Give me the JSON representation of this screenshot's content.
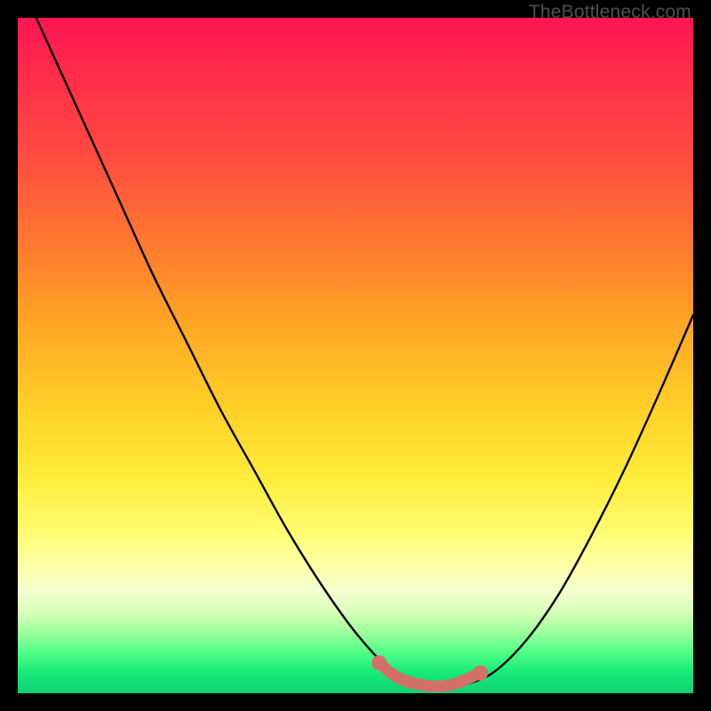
{
  "watermark": "TheBottleneck.com",
  "chart_data": {
    "type": "line",
    "title": "",
    "xlabel": "",
    "ylabel": "",
    "xlim": [
      0,
      1
    ],
    "ylim": [
      0,
      1
    ],
    "series": [
      {
        "name": "bottleneck-curve",
        "x": [
          0.0,
          0.05,
          0.1,
          0.15,
          0.2,
          0.25,
          0.3,
          0.35,
          0.4,
          0.45,
          0.5,
          0.55,
          0.575,
          0.6,
          0.625,
          0.65,
          0.7,
          0.75,
          0.8,
          0.85,
          0.9,
          0.95,
          1.0
        ],
        "y": [
          1.06,
          0.95,
          0.84,
          0.73,
          0.62,
          0.52,
          0.42,
          0.33,
          0.24,
          0.16,
          0.09,
          0.035,
          0.018,
          0.01,
          0.007,
          0.01,
          0.028,
          0.075,
          0.145,
          0.235,
          0.335,
          0.445,
          0.56
        ]
      },
      {
        "name": "overlay-dots",
        "x": [
          0.535,
          0.555,
          0.575,
          0.6,
          0.625,
          0.65,
          0.685
        ],
        "y": [
          0.045,
          0.028,
          0.018,
          0.012,
          0.01,
          0.015,
          0.03
        ]
      }
    ],
    "colors": {
      "curve": "#000000",
      "overlay": "#d56f6a"
    }
  }
}
